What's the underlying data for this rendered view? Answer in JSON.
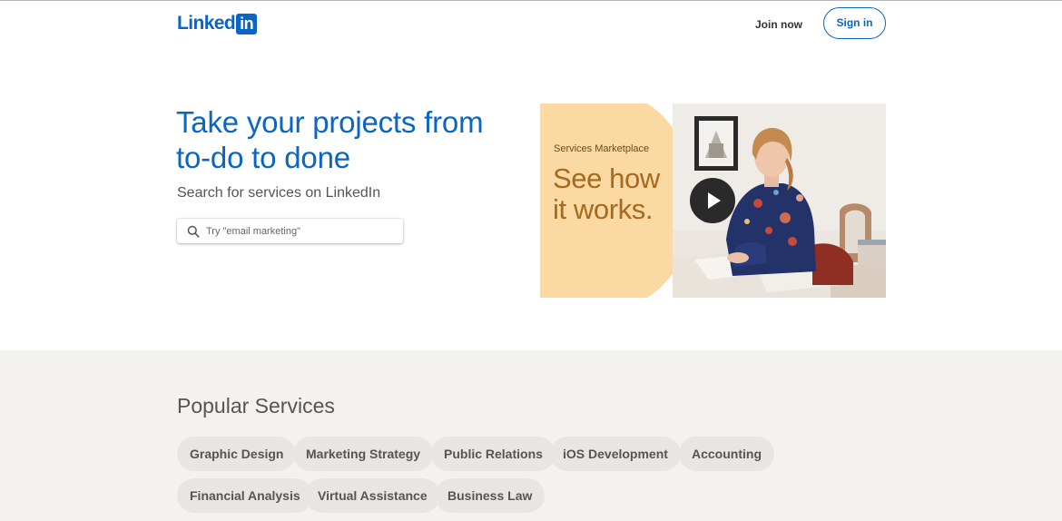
{
  "header": {
    "logo_word": "Linked",
    "logo_box": "in",
    "join_label": "Join now",
    "signin_label": "Sign in"
  },
  "hero": {
    "title_line1": "Take your projects from",
    "title_line2": "to-do to done",
    "subtitle": "Search for services on LinkedIn",
    "search_placeholder": "Try \"email marketing\""
  },
  "video": {
    "kicker": "Services Marketplace",
    "headline_line1": "See how",
    "headline_line2": "it works.",
    "icon": "play-icon"
  },
  "popular": {
    "title": "Popular Services",
    "services": [
      "Graphic Design",
      "Marketing Strategy",
      "Public Relations",
      "iOS Development",
      "Accounting",
      "Financial Analysis",
      "Virtual Assistance",
      "Business Law"
    ]
  },
  "colors": {
    "brand": "#0a66c2",
    "card_peach": "#fad9a3",
    "section_bg": "#f4f2ee"
  }
}
